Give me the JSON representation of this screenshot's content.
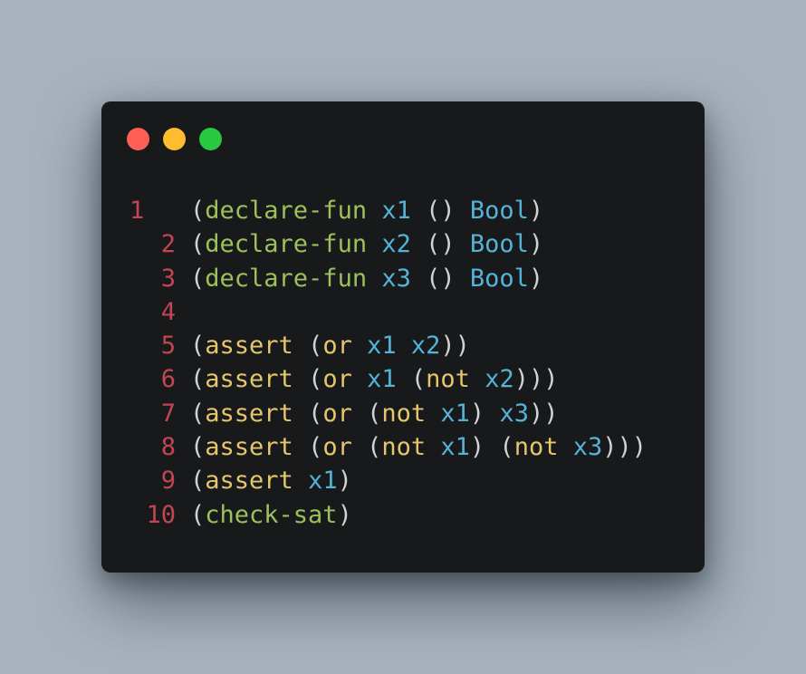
{
  "window": {
    "controls": [
      "close",
      "minimize",
      "maximize"
    ]
  },
  "colors": {
    "background": "#a8b3be",
    "window": "#18191b",
    "line_number": "#c44552",
    "paren": "#d0d2d4",
    "declare_keyword": "#9dc15a",
    "assert_keyword": "#e4c66c",
    "identifier": "#55b3d8",
    "close_dot": "#ff5f57",
    "minimize_dot": "#febc2e",
    "maximize_dot": "#28c840"
  },
  "lines": [
    {
      "number": "1",
      "tokens": [
        {
          "t": "p",
          "s": "("
        },
        {
          "t": "k",
          "s": "declare-fun"
        },
        {
          "t": "p",
          "s": " "
        },
        {
          "t": "v",
          "s": "x1"
        },
        {
          "t": "p",
          "s": " () "
        },
        {
          "t": "v",
          "s": "Bool"
        },
        {
          "t": "p",
          "s": ")"
        }
      ]
    },
    {
      "number": "2",
      "tokens": [
        {
          "t": "p",
          "s": "("
        },
        {
          "t": "k",
          "s": "declare-fun"
        },
        {
          "t": "p",
          "s": " "
        },
        {
          "t": "v",
          "s": "x2"
        },
        {
          "t": "p",
          "s": " () "
        },
        {
          "t": "v",
          "s": "Bool"
        },
        {
          "t": "p",
          "s": ")"
        }
      ]
    },
    {
      "number": "3",
      "tokens": [
        {
          "t": "p",
          "s": "("
        },
        {
          "t": "k",
          "s": "declare-fun"
        },
        {
          "t": "p",
          "s": " "
        },
        {
          "t": "v",
          "s": "x3"
        },
        {
          "t": "p",
          "s": " () "
        },
        {
          "t": "v",
          "s": "Bool"
        },
        {
          "t": "p",
          "s": ")"
        }
      ]
    },
    {
      "number": "4",
      "tokens": []
    },
    {
      "number": "5",
      "tokens": [
        {
          "t": "p",
          "s": "("
        },
        {
          "t": "a",
          "s": "assert"
        },
        {
          "t": "p",
          "s": " ("
        },
        {
          "t": "a",
          "s": "or"
        },
        {
          "t": "p",
          "s": " "
        },
        {
          "t": "v",
          "s": "x1"
        },
        {
          "t": "p",
          "s": " "
        },
        {
          "t": "v",
          "s": "x2"
        },
        {
          "t": "p",
          "s": "))"
        }
      ]
    },
    {
      "number": "6",
      "tokens": [
        {
          "t": "p",
          "s": "("
        },
        {
          "t": "a",
          "s": "assert"
        },
        {
          "t": "p",
          "s": " ("
        },
        {
          "t": "a",
          "s": "or"
        },
        {
          "t": "p",
          "s": " "
        },
        {
          "t": "v",
          "s": "x1"
        },
        {
          "t": "p",
          "s": " ("
        },
        {
          "t": "a",
          "s": "not"
        },
        {
          "t": "p",
          "s": " "
        },
        {
          "t": "v",
          "s": "x2"
        },
        {
          "t": "p",
          "s": ")))"
        }
      ]
    },
    {
      "number": "7",
      "tokens": [
        {
          "t": "p",
          "s": "("
        },
        {
          "t": "a",
          "s": "assert"
        },
        {
          "t": "p",
          "s": " ("
        },
        {
          "t": "a",
          "s": "or"
        },
        {
          "t": "p",
          "s": " ("
        },
        {
          "t": "a",
          "s": "not"
        },
        {
          "t": "p",
          "s": " "
        },
        {
          "t": "v",
          "s": "x1"
        },
        {
          "t": "p",
          "s": ") "
        },
        {
          "t": "v",
          "s": "x3"
        },
        {
          "t": "p",
          "s": "))"
        }
      ]
    },
    {
      "number": "8",
      "tokens": [
        {
          "t": "p",
          "s": "("
        },
        {
          "t": "a",
          "s": "assert"
        },
        {
          "t": "p",
          "s": " ("
        },
        {
          "t": "a",
          "s": "or"
        },
        {
          "t": "p",
          "s": " ("
        },
        {
          "t": "a",
          "s": "not"
        },
        {
          "t": "p",
          "s": " "
        },
        {
          "t": "v",
          "s": "x1"
        },
        {
          "t": "p",
          "s": ") ("
        },
        {
          "t": "a",
          "s": "not"
        },
        {
          "t": "p",
          "s": " "
        },
        {
          "t": "v",
          "s": "x3"
        },
        {
          "t": "p",
          "s": ")))"
        }
      ]
    },
    {
      "number": "9",
      "tokens": [
        {
          "t": "p",
          "s": "("
        },
        {
          "t": "a",
          "s": "assert"
        },
        {
          "t": "p",
          "s": " "
        },
        {
          "t": "v",
          "s": "x1"
        },
        {
          "t": "p",
          "s": ")"
        }
      ]
    },
    {
      "number": "10",
      "tokens": [
        {
          "t": "p",
          "s": "("
        },
        {
          "t": "k",
          "s": "check-sat"
        },
        {
          "t": "p",
          "s": ")"
        }
      ]
    }
  ]
}
